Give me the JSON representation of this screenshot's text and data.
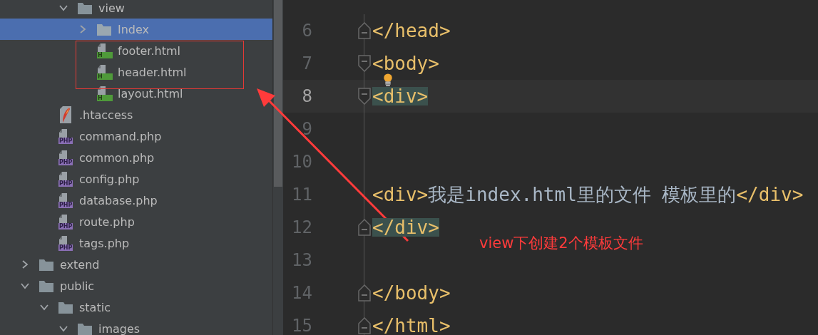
{
  "project_tree": {
    "items": [
      {
        "children": [
          {
            "children": [
              {
                "kind": "folder",
                "name": "view",
                "expanded": true,
                "selected": false,
                "children": [
                  {
                    "kind": "folder",
                    "name": "Index",
                    "expanded": false,
                    "selected": true
                  },
                  {
                    "kind": "html",
                    "name": "footer.html",
                    "badge": "H",
                    "selected": false
                  },
                  {
                    "kind": "html",
                    "name": "header.html",
                    "badge": "H",
                    "selected": false
                  },
                  {
                    "kind": "html",
                    "name": "layout.html",
                    "badge": "H",
                    "selected": false
                  }
                ]
              }
            ]
          },
          {
            "kind": "htaccess",
            "name": ".htaccess",
            "selected": false
          },
          {
            "kind": "php",
            "name": "command.php",
            "badge": "PHP",
            "selected": false
          },
          {
            "kind": "php",
            "name": "common.php",
            "badge": "PHP",
            "selected": false
          },
          {
            "kind": "php",
            "name": "config.php",
            "badge": "PHP",
            "selected": false
          },
          {
            "kind": "php",
            "name": "database.php",
            "badge": "PHP",
            "selected": false
          },
          {
            "kind": "php",
            "name": "route.php",
            "badge": "PHP",
            "selected": false
          },
          {
            "kind": "php",
            "name": "tags.php",
            "badge": "PHP",
            "selected": false
          }
        ]
      },
      {
        "kind": "folder",
        "name": "extend",
        "expanded": false,
        "selected": false
      },
      {
        "kind": "folder",
        "name": "public",
        "expanded": true,
        "selected": false,
        "children": [
          {
            "kind": "folder",
            "name": "static",
            "expanded": true,
            "selected": false,
            "children": [
              {
                "kind": "folder",
                "name": "images",
                "expanded": true,
                "selected": false
              }
            ]
          }
        ]
      }
    ]
  },
  "editor": {
    "lines": [
      {
        "number": "6",
        "fold_start": false,
        "fold_end": true,
        "current": false,
        "segments": [
          {
            "kind": "tag",
            "text": "</head>",
            "matched": false
          }
        ]
      },
      {
        "number": "7",
        "fold_start": true,
        "fold_end": false,
        "current": false,
        "intention_bulb": true,
        "segments": [
          {
            "kind": "tag",
            "text": "<body>",
            "matched": false
          }
        ]
      },
      {
        "number": "8",
        "fold_start": true,
        "fold_end": false,
        "current": true,
        "segments": [
          {
            "kind": "tag",
            "text": "<div>",
            "matched": true
          }
        ]
      },
      {
        "number": "9",
        "fold_start": false,
        "fold_end": false,
        "current": false
      },
      {
        "number": "10",
        "fold_start": false,
        "fold_end": false,
        "current": false
      },
      {
        "number": "11",
        "fold_start": false,
        "fold_end": false,
        "current": false,
        "segments": [
          {
            "kind": "tag",
            "text": "<div>",
            "matched": false
          },
          {
            "kind": "text",
            "text": "我是index.html里的文件 模板里的",
            "matched": false
          },
          {
            "kind": "tag",
            "text": "</div>",
            "matched": false
          }
        ]
      },
      {
        "number": "12",
        "fold_start": false,
        "fold_end": true,
        "current": false,
        "segments": [
          {
            "kind": "tag",
            "text": "</div>",
            "matched": true
          }
        ]
      },
      {
        "number": "13",
        "fold_start": false,
        "fold_end": false,
        "current": false
      },
      {
        "number": "14",
        "fold_start": false,
        "fold_end": true,
        "current": false,
        "segments": [
          {
            "kind": "tag",
            "text": "</body>",
            "matched": false
          }
        ]
      },
      {
        "number": "15",
        "fold_start": false,
        "fold_end": true,
        "current": false,
        "segments": [
          {
            "kind": "tag",
            "text": "</html>",
            "matched": false
          }
        ]
      }
    ]
  },
  "annotation": {
    "text": "view下创建2个模板文件"
  }
}
